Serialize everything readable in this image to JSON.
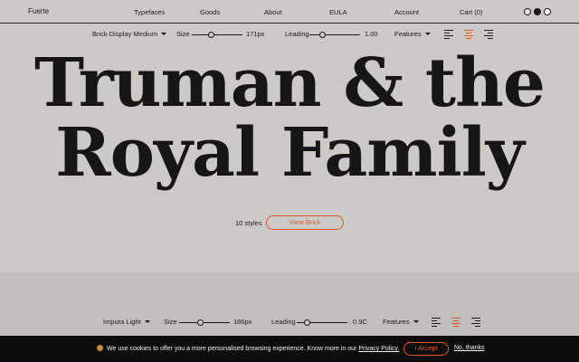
{
  "nav": {
    "brand": "Fuerte",
    "links": [
      "Typefaces",
      "Goods",
      "About",
      "EULA",
      "Account",
      "Cart (0)"
    ]
  },
  "colors": {
    "accent": "#e2572a",
    "background": "#cbcac6",
    "panel2": "#c0bfbb",
    "cookie_bg": "#0d0d0d"
  },
  "toolbar1": {
    "font": "Brick Display Medium",
    "size_label": "Size",
    "size_value": "171px",
    "leading_label": "Leading",
    "leading_value": "1.00",
    "features_label": "Features"
  },
  "specimen": {
    "line1": "Truman & the",
    "line2": "Royal Family"
  },
  "styles": {
    "count": "10 styles",
    "button": "View Brick"
  },
  "toolbar2": {
    "font": "Impura Light",
    "size_label": "Size",
    "size_value": "186px",
    "leading_label": "Leading",
    "leading_value": "0.9C",
    "features_label": "Features"
  },
  "cookie": {
    "message": "We use cookies to offer you a more personalised browsing experience. Know more in our",
    "policy_link": "Privacy Policy.",
    "accept": "I Accept",
    "decline": "No, thanks"
  }
}
